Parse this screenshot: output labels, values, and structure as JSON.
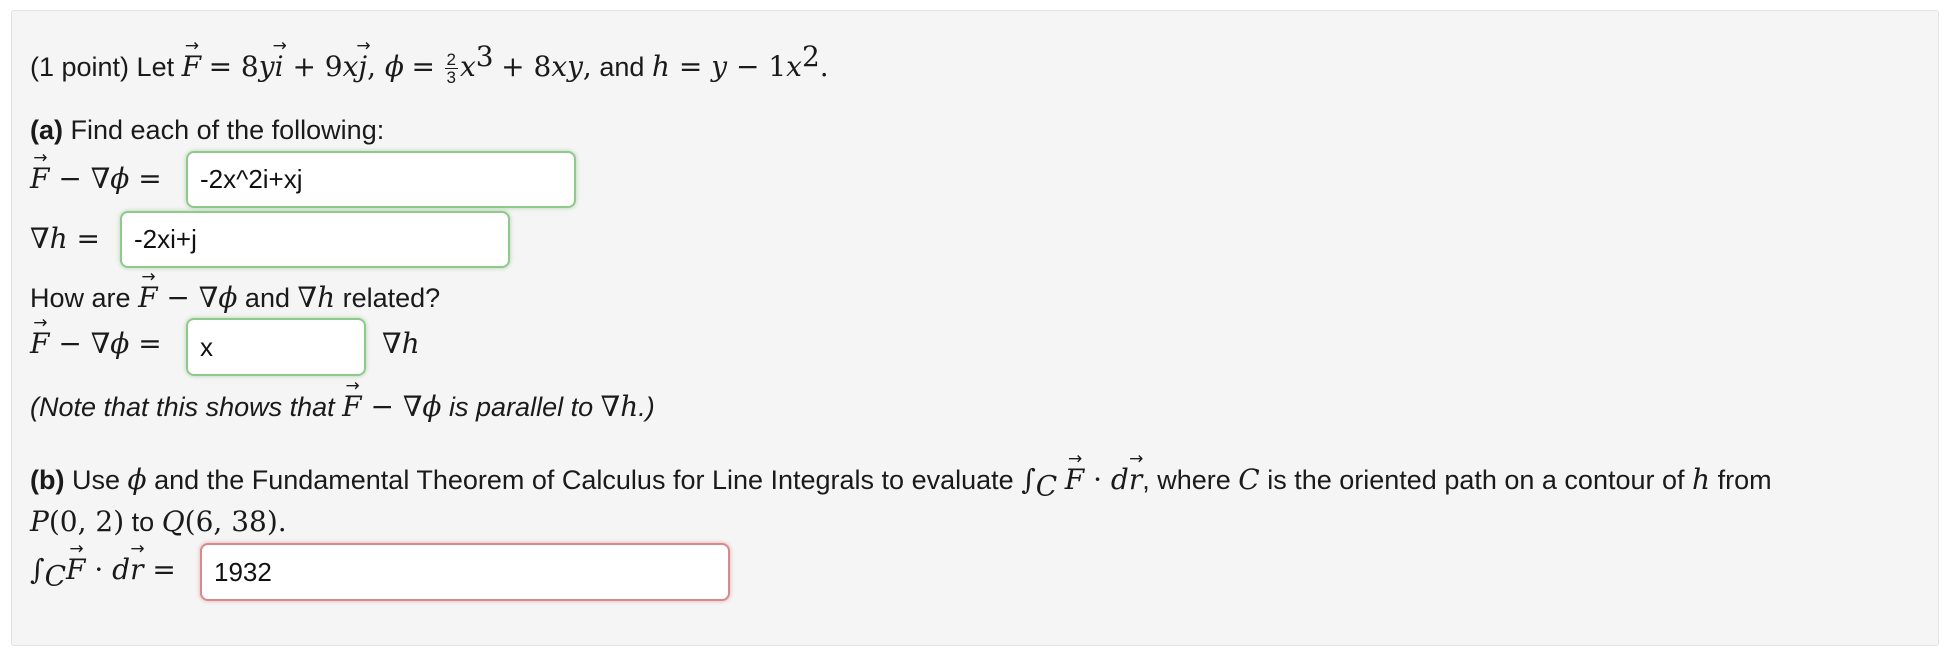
{
  "header": {
    "points": "(1 point) Let",
    "F_def": "= 8",
    "phi_def": "= ",
    "h_def": "= y − 1x",
    "and": ", and"
  },
  "partA": {
    "label": "(a)",
    "prompt": "Find each of the following:",
    "relation_q_start": "How are",
    "relation_q_and": "and",
    "relation_q_end": "related?",
    "note_start": "(Note that this shows that",
    "note_end": "is parallel to"
  },
  "partB": {
    "label": "(b)",
    "prompt_1": "Use",
    "prompt_2": "and the Fundamental Theorem of Calculus for Line Integrals to evaluate",
    "prompt_3": ", where",
    "prompt_4": "is the oriented path on a contour of",
    "prompt_5": "from",
    "prompt_6": "to"
  },
  "inputs": {
    "grad_diff": "-2x^2i+xj",
    "grad_h": "-2xi+j",
    "multiplier": "x",
    "integral": "1932"
  }
}
